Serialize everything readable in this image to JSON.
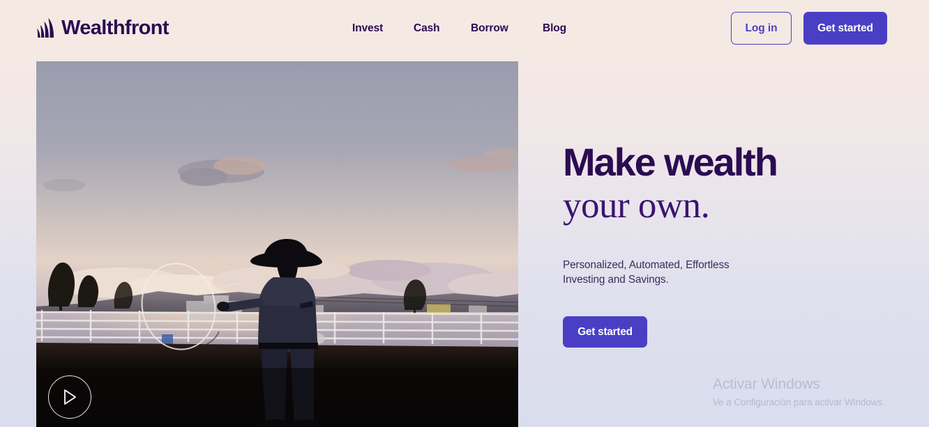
{
  "brand": {
    "name": "Wealthfront",
    "logo_icon": "wealthfront-bars-logo",
    "color": "#2b0b52"
  },
  "nav": {
    "items": [
      {
        "label": "Invest"
      },
      {
        "label": "Cash"
      },
      {
        "label": "Borrow"
      },
      {
        "label": "Blog"
      }
    ]
  },
  "header_actions": {
    "login_label": "Log in",
    "get_started_label": "Get started",
    "accent": "#4a3fc4"
  },
  "video": {
    "play_icon": "play-triangle-icon",
    "scene_description": "Cowboy silhouette spinning a lasso in a rodeo arena at dusk"
  },
  "hero": {
    "headline_bold": "Make wealth",
    "headline_serif": "your own.",
    "subtext_line1": "Personalized, Automated, Effortless",
    "subtext_line2": "Investing and Savings.",
    "cta_label": "Get started"
  },
  "watermark": {
    "title": "Activar Windows",
    "subtitle": "Ve a Configuración para activar Windows."
  }
}
